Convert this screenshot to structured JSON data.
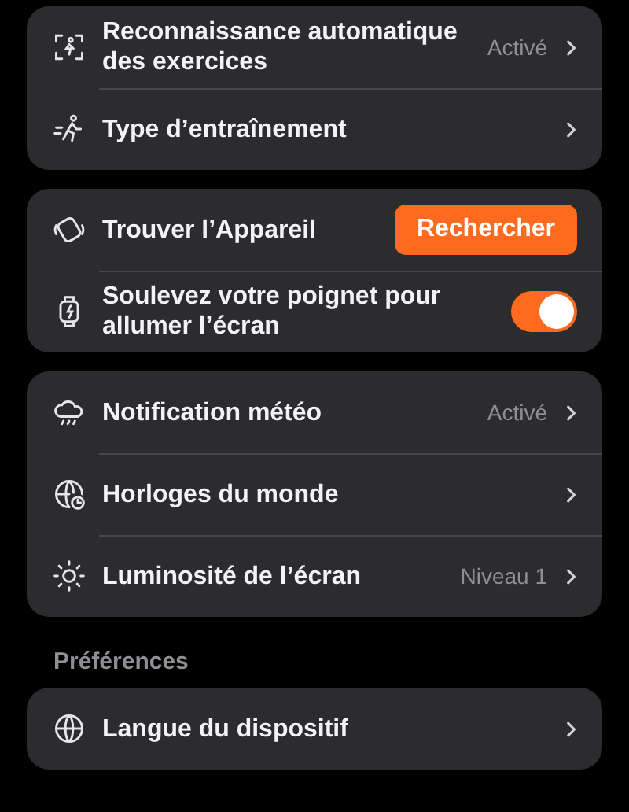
{
  "sections": [
    {
      "rows": [
        {
          "kind": "nav",
          "label": "Reconnaissance automatique des exercices",
          "value": "Activé"
        },
        {
          "kind": "nav",
          "label": "Type d’entraînement"
        }
      ]
    },
    {
      "rows": [
        {
          "kind": "button",
          "label": "Trouver l’Appareil",
          "button": "Rechercher"
        },
        {
          "kind": "toggle",
          "label": "Soulevez votre poignet pour allumer l’écran",
          "on": true
        }
      ]
    },
    {
      "rows": [
        {
          "kind": "nav",
          "label": "Notification météo",
          "value": "Activé"
        },
        {
          "kind": "nav",
          "label": "Horloges du monde"
        },
        {
          "kind": "nav",
          "label": "Luminosité de l’écran",
          "value": "Niveau 1"
        }
      ]
    },
    {
      "header": "Préférences",
      "rows": [
        {
          "kind": "nav",
          "label": "Langue du dispositif"
        }
      ]
    }
  ]
}
